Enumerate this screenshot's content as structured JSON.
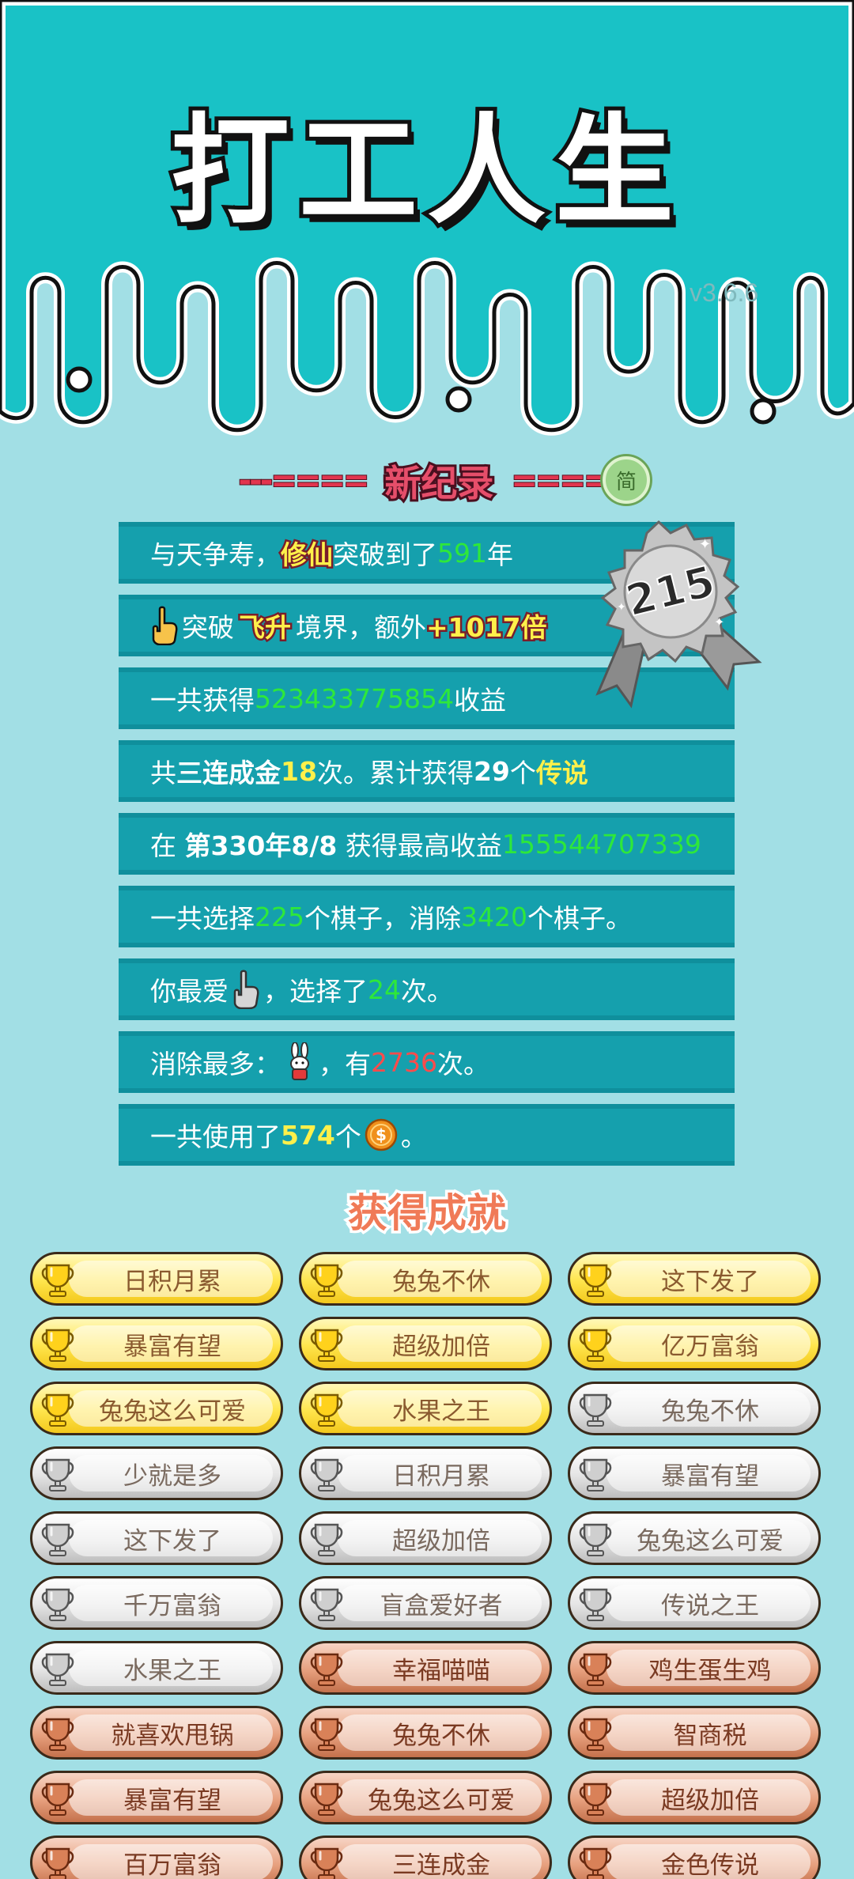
{
  "app": {
    "title": "打工人生",
    "version": "v3.6.6"
  },
  "record": {
    "heading_left": "---====",
    "heading": "新纪录",
    "heading_right": "====",
    "simplified_badge": "简",
    "medal_number": "215"
  },
  "stats": {
    "row1": {
      "a": "与天争寿，",
      "b": "修仙",
      "c": "突破到了",
      "d": "591",
      "e": "年"
    },
    "row2": {
      "a": "突破",
      "b": "飞升",
      "c": "境界，额外",
      "d": "+1017倍"
    },
    "row3": {
      "a": "一共获得",
      "b": "523433775854",
      "c": "收益"
    },
    "row4": {
      "a": "共",
      "b": "三连成金",
      "c": "18",
      "d": "次。累计获得",
      "e": "29",
      "f": "个",
      "g": "传说"
    },
    "row5": {
      "a": "在 ",
      "b": "第330年8/8",
      "c": " 获得最高收益",
      "d": "155544707339"
    },
    "row6": {
      "a": "一共选择",
      "b": "225",
      "c": "个棋子，消除",
      "d": "3420",
      "e": "个棋子。"
    },
    "row7": {
      "a": "你最爱",
      "b": "，选择了",
      "c": "24",
      "d": "次。"
    },
    "row8": {
      "a": "消除最多：",
      "b": "，有",
      "c": "2736",
      "d": "次。"
    },
    "row9": {
      "a": "一共使用了",
      "b": "574",
      "c": "个",
      "d": "。"
    }
  },
  "achievements": {
    "title": "获得成就",
    "items": [
      {
        "label": "日积月累",
        "tier": "gold"
      },
      {
        "label": "兔兔不休",
        "tier": "gold"
      },
      {
        "label": "这下发了",
        "tier": "gold"
      },
      {
        "label": "暴富有望",
        "tier": "gold"
      },
      {
        "label": "超级加倍",
        "tier": "gold"
      },
      {
        "label": "亿万富翁",
        "tier": "gold"
      },
      {
        "label": "兔兔这么可爱",
        "tier": "gold"
      },
      {
        "label": "水果之王",
        "tier": "gold"
      },
      {
        "label": "兔兔不休",
        "tier": "silver"
      },
      {
        "label": "少就是多",
        "tier": "silver"
      },
      {
        "label": "日积月累",
        "tier": "silver"
      },
      {
        "label": "暴富有望",
        "tier": "silver"
      },
      {
        "label": "这下发了",
        "tier": "silver"
      },
      {
        "label": "超级加倍",
        "tier": "silver"
      },
      {
        "label": "兔兔这么可爱",
        "tier": "silver"
      },
      {
        "label": "千万富翁",
        "tier": "silver"
      },
      {
        "label": "盲盒爱好者",
        "tier": "silver"
      },
      {
        "label": "传说之王",
        "tier": "silver"
      },
      {
        "label": "水果之王",
        "tier": "silver"
      },
      {
        "label": "幸福喵喵",
        "tier": "bronze"
      },
      {
        "label": "鸡生蛋生鸡",
        "tier": "bronze"
      },
      {
        "label": "就喜欢甩锅",
        "tier": "bronze"
      },
      {
        "label": "兔兔不休",
        "tier": "bronze"
      },
      {
        "label": "智商税",
        "tier": "bronze"
      },
      {
        "label": "暴富有望",
        "tier": "bronze"
      },
      {
        "label": "兔兔这么可爱",
        "tier": "bronze"
      },
      {
        "label": "超级加倍",
        "tier": "bronze"
      },
      {
        "label": "百万富翁",
        "tier": "bronze"
      },
      {
        "label": "三连成金",
        "tier": "bronze"
      },
      {
        "label": "金色传说",
        "tier": "bronze"
      }
    ]
  },
  "colors": {
    "header_teal": "#19c2c6",
    "background": "#a2dfe5",
    "row_teal": "#15a0ad",
    "green_value": "#2ee83a",
    "yellow_value": "#fff04a",
    "red_value": "#ff4b4b"
  },
  "icons": {
    "row2": "pointing-hand-icon",
    "row7": "gray-pointing-hand-icon",
    "row8": "rabbit-icon",
    "row9": "coin-icon"
  }
}
